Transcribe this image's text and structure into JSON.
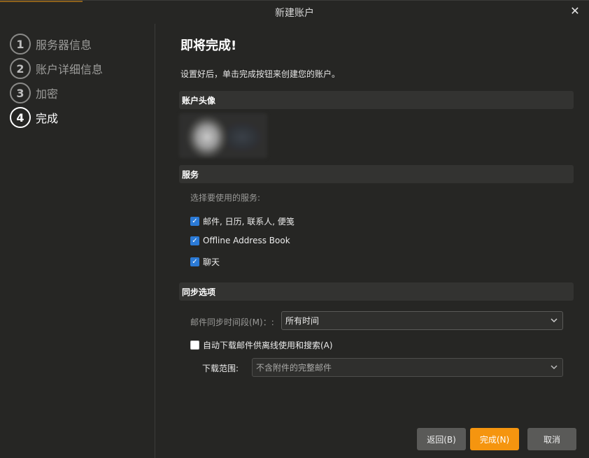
{
  "window": {
    "title": "新建账户"
  },
  "steps": [
    {
      "num": "1",
      "label": "服务器信息"
    },
    {
      "num": "2",
      "label": "账户详细信息"
    },
    {
      "num": "3",
      "label": "加密"
    },
    {
      "num": "4",
      "label": "完成"
    }
  ],
  "main": {
    "heading": "即将完成!",
    "description": "设置好后，单击完成按钮来创建您的账户。",
    "avatar_section": "账户头像",
    "services_section": "服务",
    "services_hint": "选择要使用的服务:",
    "services": [
      {
        "label": "邮件, 日历, 联系人, 便笺",
        "checked": true
      },
      {
        "label": "Offline Address Book",
        "checked": true
      },
      {
        "label": "聊天",
        "checked": true
      }
    ],
    "sync_section": "同步选项",
    "sync_period_label": "邮件同步时间段(M)：:",
    "sync_period_value": "所有时间",
    "auto_download_label": "自动下载邮件供离线使用和搜索(A)",
    "auto_download_checked": false,
    "download_scope_label": "下载范围:",
    "download_scope_value": "不含附件的完整邮件"
  },
  "buttons": {
    "back": "返回(B)",
    "finish": "完成(N)",
    "cancel": "取消"
  },
  "colors": {
    "accent": "#f5950f",
    "checkbox": "#2b7ad6",
    "background": "#262624"
  },
  "icons": {
    "close": "close-icon",
    "dropdown": "chevron-down-icon",
    "check": "check-icon"
  }
}
